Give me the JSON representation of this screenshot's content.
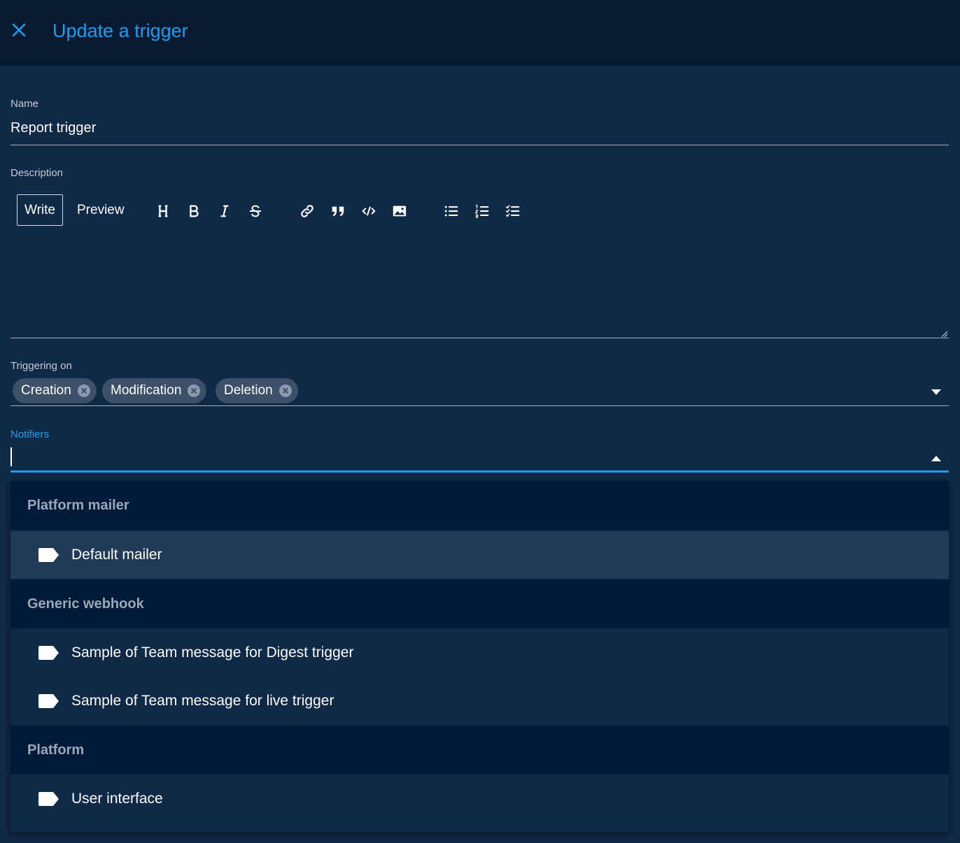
{
  "header": {
    "title": "Update a trigger",
    "close_icon": "close-icon"
  },
  "form": {
    "name": {
      "label": "Name",
      "value": "Report trigger"
    },
    "description": {
      "label": "Description",
      "tabs": {
        "write": "Write",
        "preview": "Preview"
      },
      "toolbar_icons": [
        "heading-icon",
        "bold-icon",
        "italic-icon",
        "strikethrough-icon",
        "link-icon",
        "quote-icon",
        "code-icon",
        "image-icon",
        "bulleted-list-icon",
        "numbered-list-icon",
        "checklist-icon"
      ],
      "value": ""
    },
    "triggering_on": {
      "label": "Triggering on",
      "chips": [
        "Creation",
        "Modification",
        "Deletion"
      ]
    },
    "notifiers": {
      "label": "Notifiers",
      "value": "",
      "groups": [
        {
          "name": "Platform mailer",
          "options": [
            {
              "label": "Default mailer",
              "highlighted": true
            }
          ]
        },
        {
          "name": "Generic webhook",
          "options": [
            {
              "label": "Sample of Team message for Digest trigger"
            },
            {
              "label": "Sample of Team message for live trigger"
            }
          ]
        },
        {
          "name": "Platform",
          "options": [
            {
              "label": "User interface"
            }
          ]
        }
      ]
    }
  },
  "colors": {
    "accent": "#1c9ef0",
    "background": "#0f2a46",
    "header_background": "#071a30",
    "group_header_background": "#001a39",
    "chip_background": "#3c5068",
    "highlight_background": "#203a57"
  }
}
